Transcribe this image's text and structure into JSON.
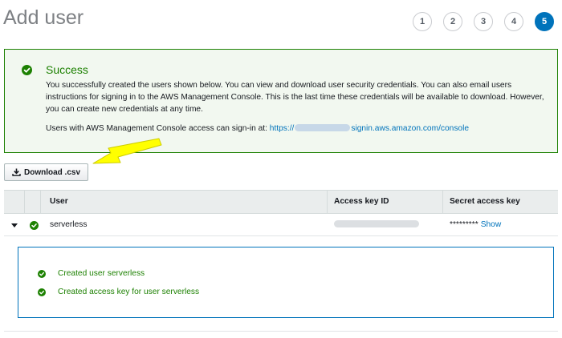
{
  "page": {
    "title": "Add user"
  },
  "steps": [
    "1",
    "2",
    "3",
    "4",
    "5"
  ],
  "active_step": "5",
  "alert": {
    "title": "Success",
    "message": "You successfully created the users shown below. You can view and download user security credentials. You can also email users instructions for signing in to the AWS Management Console. This is the last time these credentials will be available to download. However, you can create new credentials at any time.",
    "signin_prefix": "Users with AWS Management Console access can sign-in at:",
    "signin_url_start": "https://",
    "signin_url_end": "signin.aws.amazon.com/console"
  },
  "toolbar": {
    "download_label": "Download .csv"
  },
  "table": {
    "columns": [
      "User",
      "Access key ID",
      "Secret access key"
    ],
    "rows": [
      {
        "user": "serverless",
        "secret_masked": "*********",
        "show_label": "Show"
      }
    ]
  },
  "details": {
    "items": [
      "Created user serverless",
      "Created access key for user serverless"
    ]
  },
  "colors": {
    "success": "#1d8102",
    "link": "#0073bb",
    "annotation_arrow": "#ffff00"
  },
  "icons": {
    "success": "check-circle-icon",
    "download": "download-icon",
    "expand": "caret-down-icon",
    "annotation": "arrow-icon"
  }
}
